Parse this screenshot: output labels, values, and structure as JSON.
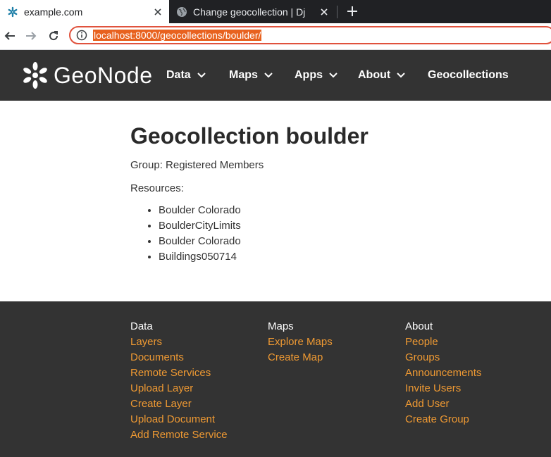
{
  "browser": {
    "tabs": [
      {
        "title": "example.com",
        "active": true
      },
      {
        "title": "Change geocollection | Dj",
        "active": false
      }
    ],
    "address": "localhost:8000/geocollections/boulder/"
  },
  "header": {
    "logo_text": "GeoNode",
    "nav": [
      {
        "label": "Data",
        "has_dropdown": true
      },
      {
        "label": "Maps",
        "has_dropdown": true
      },
      {
        "label": "Apps",
        "has_dropdown": true
      },
      {
        "label": "About",
        "has_dropdown": true
      },
      {
        "label": "Geocollections",
        "has_dropdown": false
      }
    ]
  },
  "main": {
    "title": "Geocollection boulder",
    "group_line": "Group: Registered Members",
    "resources_label": "Resources:",
    "resources": [
      "Boulder Colorado",
      "BoulderCityLimits",
      "Boulder Colorado",
      "Buildings050714"
    ]
  },
  "footer": {
    "columns": [
      {
        "heading": "Data",
        "links": [
          "Layers",
          "Documents",
          "Remote Services",
          "Upload Layer",
          "Create Layer",
          "Upload Document",
          "Add Remote Service"
        ]
      },
      {
        "heading": "Maps",
        "links": [
          "Explore Maps",
          "Create Map"
        ]
      },
      {
        "heading": "About",
        "links": [
          "People",
          "Groups",
          "Announcements",
          "Invite Users",
          "Add User",
          "Create Group"
        ]
      }
    ]
  },
  "colors": {
    "header_bg": "#333333",
    "footer_link": "#ee9933",
    "url_highlight": "#e8621f"
  }
}
